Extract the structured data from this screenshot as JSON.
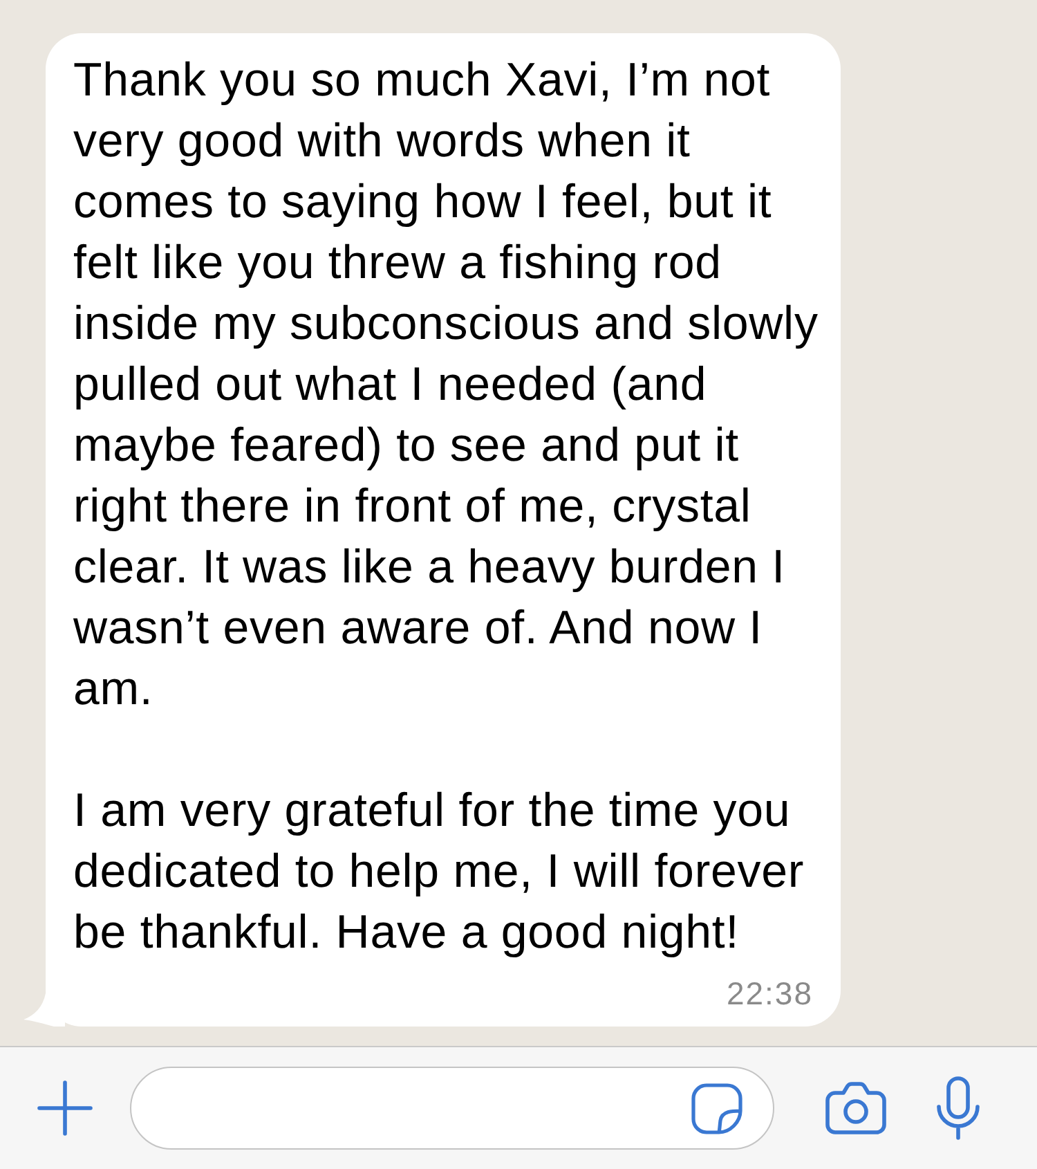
{
  "message": {
    "paragraphs": [
      "Thank you so much Xavi, I’m not very good with words when it comes to saying how I feel, but it felt like you threw a fishing rod inside my subconscious and slowly pulled out what I needed (and maybe feared) to see and put it right there in front of me, crystal clear. It was like a heavy burden I wasn’t even aware of. And now I am.",
      "I am very grateful for the time you dedicated to help me, I will forever be thankful. Have a good night!"
    ],
    "time": "22:38"
  }
}
